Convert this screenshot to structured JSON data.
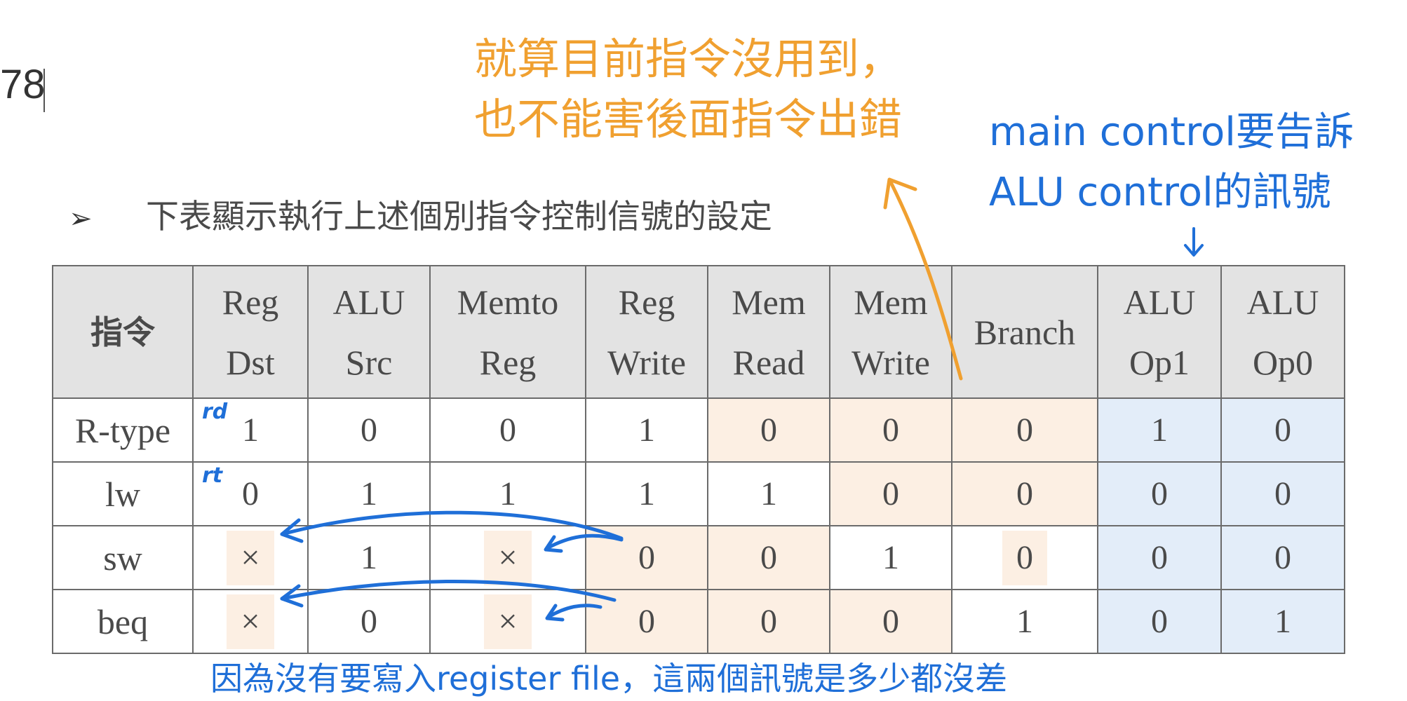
{
  "page_number": "78",
  "annotations": {
    "orange_line1": "就算目前指令沒用到，",
    "orange_line2": "也不能害後面指令出錯",
    "blue_right_line1": "main control要告訴",
    "blue_right_line2": "ALU control的訊號",
    "blue_bottom": "因為沒有要寫入register file，這兩個訊號是多少都沒差",
    "hand_rd": "rd",
    "hand_rt": "rt"
  },
  "heading": {
    "bullet": "➢",
    "text": "下表顯示執行上述個別指令控制信號的設定"
  },
  "table": {
    "headers": [
      {
        "line1": "指令",
        "line2": ""
      },
      {
        "line1": "Reg",
        "line2": "Dst"
      },
      {
        "line1": "ALU",
        "line2": "Src"
      },
      {
        "line1": "Memto",
        "line2": "Reg"
      },
      {
        "line1": "Reg",
        "line2": "Write"
      },
      {
        "line1": "Mem",
        "line2": "Read"
      },
      {
        "line1": "Mem",
        "line2": "Write"
      },
      {
        "line1": "Branch",
        "line2": ""
      },
      {
        "line1": "ALU",
        "line2": "Op1"
      },
      {
        "line1": "ALU",
        "line2": "Op0"
      }
    ],
    "rows": [
      {
        "name": "R-type",
        "values": [
          "1",
          "0",
          "0",
          "1",
          "0",
          "0",
          "0",
          "1",
          "0"
        ]
      },
      {
        "name": "lw",
        "values": [
          "0",
          "1",
          "1",
          "1",
          "1",
          "0",
          "0",
          "0",
          "0"
        ]
      },
      {
        "name": "sw",
        "values": [
          "×",
          "1",
          "×",
          "0",
          "0",
          "1",
          "0",
          "0",
          "0"
        ]
      },
      {
        "name": "beq",
        "values": [
          "×",
          "0",
          "×",
          "0",
          "0",
          "0",
          "1",
          "0",
          "1"
        ]
      }
    ]
  },
  "colors": {
    "orange_annotation": "#f0a030",
    "blue_annotation": "#1f6fd8",
    "orange_highlight": "#fcefe3",
    "blue_highlight": "#e3edf9",
    "header_background": "#e3e3e3"
  }
}
